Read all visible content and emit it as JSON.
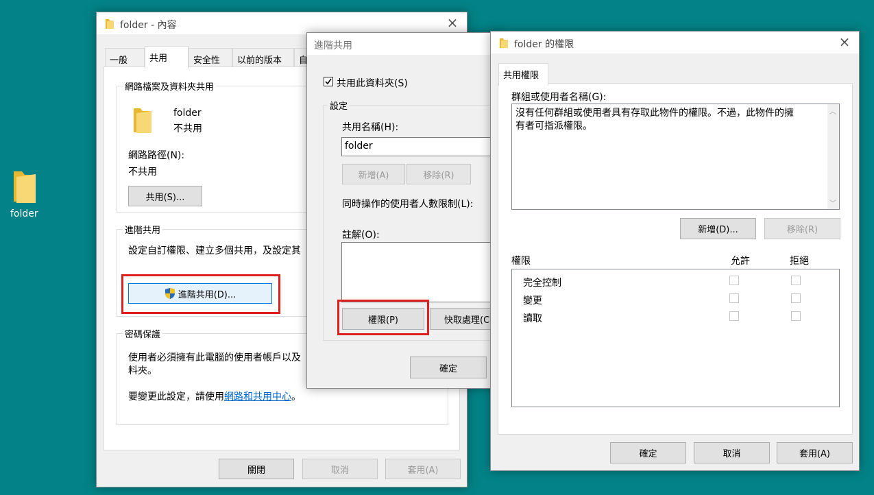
{
  "desktop": {
    "folder_label": "folder"
  },
  "props": {
    "title": "folder - 內容",
    "tabs": [
      "一般",
      "共用",
      "安全性",
      "以前的版本",
      "自"
    ],
    "network_group_title": "網路檔案及資料夾共用",
    "folder_name": "folder",
    "folder_status": "不共用",
    "network_path_label": "網路路徑(N):",
    "network_path_value": "不共用",
    "share_button": "共用(S)...",
    "advanced_group_title": "進階共用",
    "advanced_desc": "設定自訂權限、建立多個共用，及設定其",
    "advanced_button": "進階共用(D)...",
    "password_group_title": "密碼保護",
    "password_desc_1": "使用者必須擁有此電腦的使用者帳戶以及",
    "password_desc_2": "料夾。",
    "change_prefix": "要變更此設定，請使用",
    "change_link": "網路和共用中心",
    "change_suffix": "。",
    "buttons": {
      "close": "關閉",
      "cancel": "取消",
      "apply": "套用(A)"
    }
  },
  "advanced": {
    "title": "進階共用",
    "share_checkbox": "共用此資料夾(S)",
    "settings_title": "設定",
    "share_name_label": "共用名稱(H):",
    "share_name_value": "folder",
    "add_button": "新增(A)",
    "remove_button": "移除(R)",
    "limit_label": "同時操作的使用者人數限制(L):",
    "comment_label": "註解(O):",
    "permissions_button": "權限(P)",
    "caching_button": "快取處理(C",
    "ok_button": "確定"
  },
  "perms": {
    "title": "folder 的權限",
    "tab": "共用權限",
    "group_label": "群組或使用者名稱(G):",
    "group_message_1": "沒有任何群組或使用者具有存取此物件的權限。不過，此物件的擁",
    "group_message_2": "有者可指派權限。",
    "add_button": "新增(D)...",
    "remove_button": "移除(R)",
    "perm_header": "權限",
    "allow_header": "允許",
    "deny_header": "拒絕",
    "rows": [
      "完全控制",
      "變更",
      "讀取"
    ],
    "buttons": {
      "ok": "確定",
      "cancel": "取消",
      "apply": "套用(A)"
    }
  }
}
